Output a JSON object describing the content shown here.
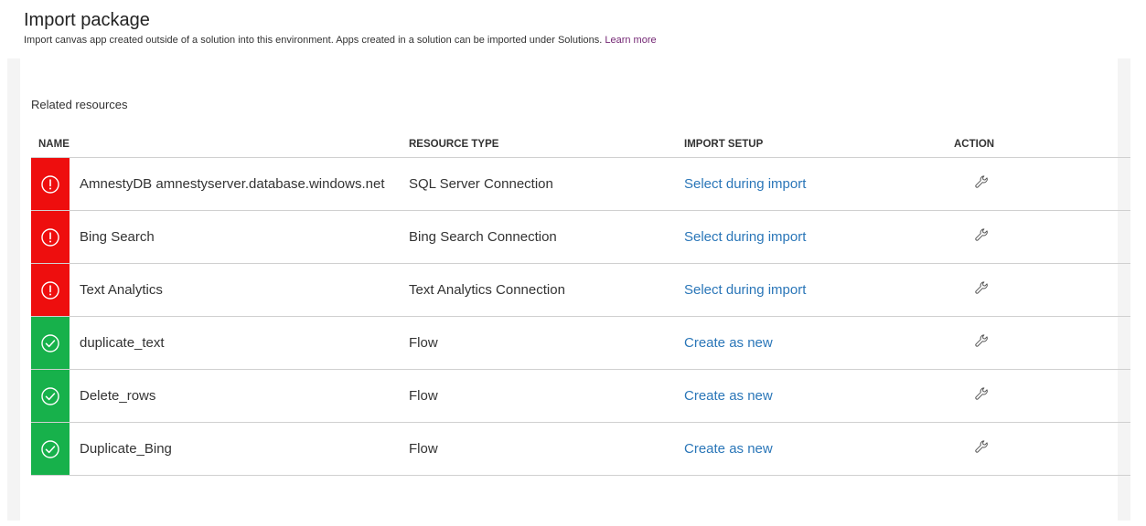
{
  "header": {
    "title": "Import package",
    "description": "Import canvas app created outside of a solution into this environment. Apps created in a solution can be imported under Solutions.",
    "learn_more": "Learn more"
  },
  "section_label": "Related resources",
  "columns": {
    "name": "NAME",
    "resource_type": "RESOURCE TYPE",
    "import_setup": "IMPORT SETUP",
    "action": "ACTION"
  },
  "rows": [
    {
      "status": "error",
      "status_icon": "error-icon",
      "name": "AmnestyDB amnestyserver.database.windows.net",
      "resource_type": "SQL Server Connection",
      "import_setup": "Select during import",
      "action_icon": "wrench-icon"
    },
    {
      "status": "error",
      "status_icon": "error-icon",
      "name": "Bing Search",
      "resource_type": "Bing Search Connection",
      "import_setup": "Select during import",
      "action_icon": "wrench-icon"
    },
    {
      "status": "error",
      "status_icon": "error-icon",
      "name": "Text Analytics",
      "resource_type": "Text Analytics Connection",
      "import_setup": "Select during import",
      "action_icon": "wrench-icon"
    },
    {
      "status": "ok",
      "status_icon": "check-icon",
      "name": "duplicate_text",
      "resource_type": "Flow",
      "import_setup": "Create as new",
      "action_icon": "wrench-icon"
    },
    {
      "status": "ok",
      "status_icon": "check-icon",
      "name": "Delete_rows",
      "resource_type": "Flow",
      "import_setup": "Create as new",
      "action_icon": "wrench-icon"
    },
    {
      "status": "ok",
      "status_icon": "check-icon",
      "name": "Duplicate_Bing",
      "resource_type": "Flow",
      "import_setup": "Create as new",
      "action_icon": "wrench-icon"
    }
  ],
  "colors": {
    "error": "#ee0e0e",
    "ok": "#17b14b",
    "link": "#2a76b8",
    "learn_more_link": "#742774",
    "panel_bg": "#f4f4f4"
  }
}
